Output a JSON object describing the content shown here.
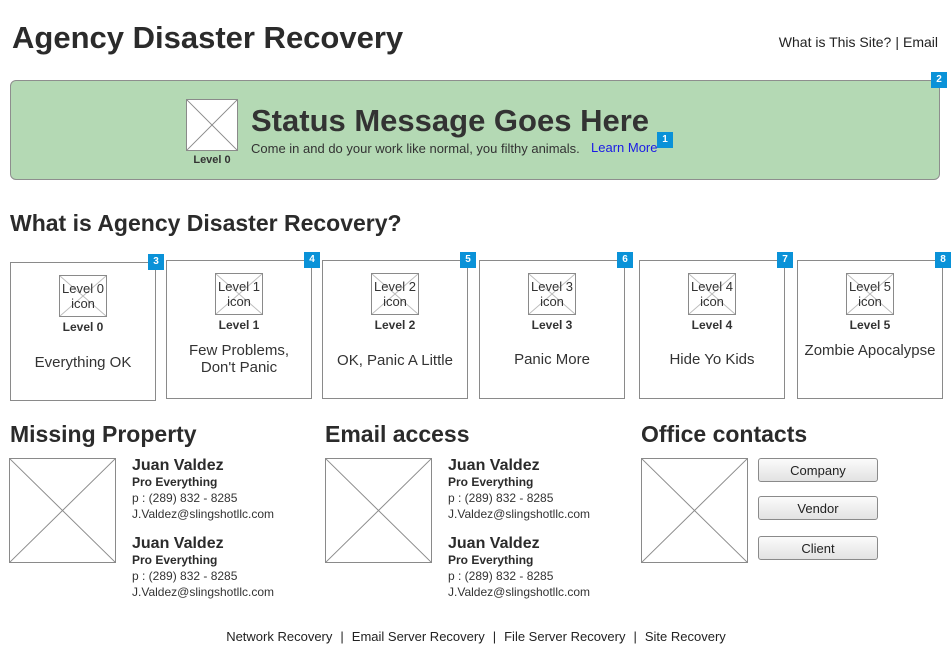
{
  "header": {
    "title": "Agency Disaster Recovery",
    "links": [
      "What is This Site?",
      "Email"
    ]
  },
  "status": {
    "badge": "2",
    "image_label": "Level 0",
    "title": "Status Message Goes Here",
    "message": "Come in and do your work like normal, you filthy animals.",
    "learn_more": "Learn More",
    "learn_more_badge": "1"
  },
  "levels_section": {
    "heading": "What is Agency Disaster Recovery?",
    "cards": [
      {
        "badge": "3",
        "icon_text": "Level 0 icon",
        "level": "Level 0",
        "description": "Everything OK"
      },
      {
        "badge": "4",
        "icon_text": "Level 1 icon",
        "level": "Level 1",
        "description": "Few Problems, Don't Panic"
      },
      {
        "badge": "5",
        "icon_text": "Level 2 icon",
        "level": "Level 2",
        "description": "OK, Panic A Little"
      },
      {
        "badge": "6",
        "icon_text": "Level 3 icon",
        "level": "Level 3",
        "description": "Panic More"
      },
      {
        "badge": "7",
        "icon_text": "Level 4 icon",
        "level": "Level 4",
        "description": "Hide Yo Kids"
      },
      {
        "badge": "8",
        "icon_text": "Level 5 icon",
        "level": "Level 5",
        "description": "Zombie Apocalypse"
      }
    ]
  },
  "missing_property": {
    "heading": "Missing Property",
    "contacts": [
      {
        "name": "Juan Valdez",
        "role": "Pro Everything",
        "phone": "p : (289) 832 - 8285",
        "email": "J.Valdez@slingshotllc.com"
      },
      {
        "name": "Juan Valdez",
        "role": "Pro Everything",
        "phone": "p : (289) 832 - 8285",
        "email": "J.Valdez@slingshotllc.com"
      }
    ]
  },
  "email_access": {
    "heading": "Email access",
    "contacts": [
      {
        "name": "Juan Valdez",
        "role": "Pro Everything",
        "phone": "p : (289) 832 - 8285",
        "email": "J.Valdez@slingshotllc.com"
      },
      {
        "name": "Juan Valdez",
        "role": "Pro Everything",
        "phone": "p : (289) 832 - 8285",
        "email": "J.Valdez@slingshotllc.com"
      }
    ]
  },
  "office_contacts": {
    "heading": "Office contacts",
    "buttons": [
      "Company",
      "Vendor",
      "Client"
    ]
  },
  "footer": {
    "links": [
      "Network Recovery",
      "Email Server Recovery",
      "File Server Recovery",
      "Site Recovery"
    ]
  },
  "colors": {
    "status_background": "#b4d9b4",
    "badge": "#0a92d8",
    "link": "#1a1ae6"
  }
}
